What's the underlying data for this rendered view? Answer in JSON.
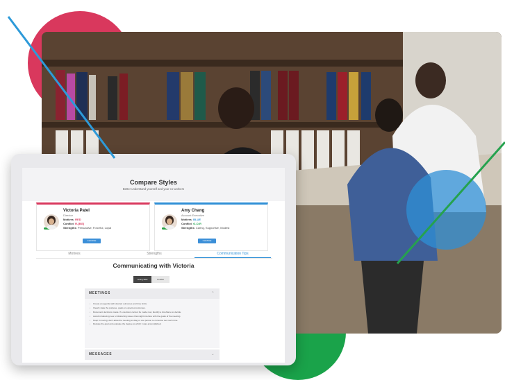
{
  "app": {
    "title": "Compare Styles",
    "subtitle": "Better understand yourself and your co-workers"
  },
  "profiles": [
    {
      "name": "Victoria Patel",
      "role": "Director",
      "motives_label": "Motives",
      "motives_value": "RED",
      "conflict_label": "Conflict",
      "conflict_value": "R-[BG]",
      "strengths_label": "Strengths",
      "strengths_value": "Persuasive, Forceful, Loyal",
      "change_label": "CHANGE",
      "accent": "#d9385d"
    },
    {
      "name": "Amy Chang",
      "role": "Account Executive",
      "motives_label": "Motives",
      "motives_value": "BLUE",
      "conflict_label": "Conflict",
      "conflict_value": "G-O-R",
      "strengths_label": "Strengths",
      "strengths_value": "Caring, Supportive, Modest",
      "change_label": "CHANGE",
      "accent": "#2f8fd6"
    }
  ],
  "tabs": [
    "Motives",
    "Strengths",
    "Communication Tips"
  ],
  "active_tab": "Communication Tips",
  "section_title": "Communicating with Victoria",
  "toggle": {
    "on": "Going Well",
    "off": "Conflict"
  },
  "meetings": {
    "label": "MEETINGS",
    "items": [
      "Create an agenda with desired outcomes and time limits.",
      "Clearly state the purpose, goals or expected outcomes.",
      "Document decisions made. If a decision cannot be made now, identify a timeframe to decide.",
      "Avoid introducing new or distracting issues that might interfere with the goals of the meeting.",
      "Keep it moving; don't allow the meeting to drag or one person to consume too much time.",
      "Restate the goal and evaluate the degree to which it was accomplished."
    ]
  },
  "messages": {
    "label": "MESSAGES"
  },
  "colors": {
    "red": "#d9385d",
    "green": "#1aa34a",
    "blue": "#2f8fd6"
  }
}
